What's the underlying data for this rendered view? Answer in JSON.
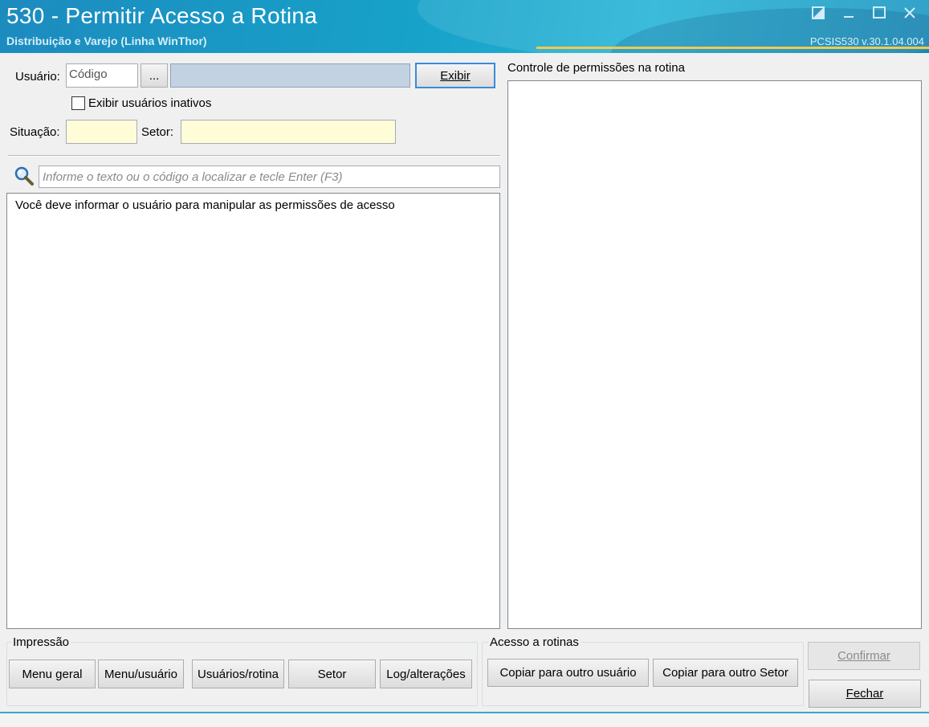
{
  "window": {
    "title": "530 - Permitir Acesso a Rotina",
    "subtitle": "Distribuição e Varejo (Linha WinThor)",
    "version": "PCSIS530  v.30.1.04.004"
  },
  "form": {
    "usuario_label": "Usuário:",
    "usuario_code_placeholder": "Código",
    "ellipsis_label": "...",
    "exibir_label": "Exibir",
    "inactive_checkbox_label": "Exibir usuários inativos",
    "situacao_label": "Situação:",
    "setor_label": "Setor:"
  },
  "search": {
    "placeholder": "Informe o texto ou o código a localizar e tecle Enter (F3)"
  },
  "routines_list": {
    "message": "Você deve informar o usuário para manipular as permissões de acesso"
  },
  "permissions": {
    "label": "Controle de permissões na rotina"
  },
  "impressao": {
    "title": "Impressão",
    "buttons": [
      "Menu geral",
      "Menu/usuário",
      "Usuários/rotina",
      "Setor",
      "Log/alterações"
    ]
  },
  "acesso": {
    "title": "Acesso a rotinas",
    "buttons": [
      "Copiar para outro usuário",
      "Copiar para outro Setor"
    ]
  },
  "actions": {
    "confirmar": "Confirmar",
    "fechar": "Fechar"
  }
}
